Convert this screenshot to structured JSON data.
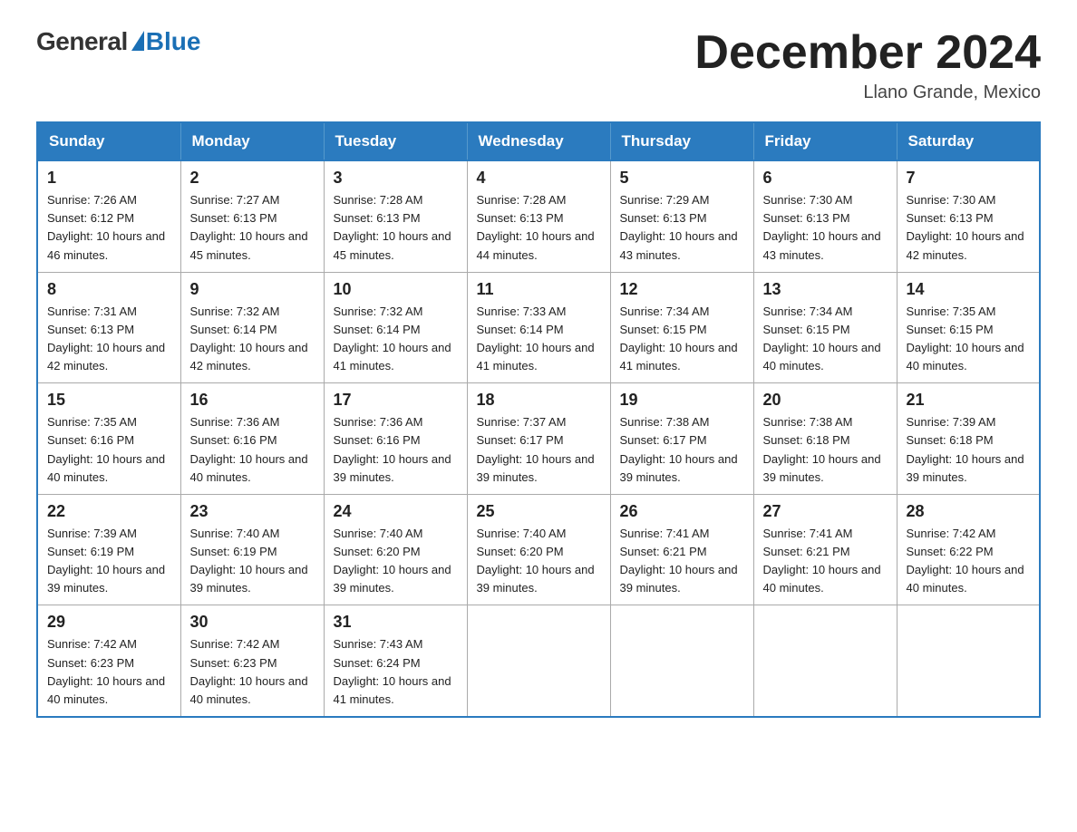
{
  "header": {
    "logo_general": "General",
    "logo_blue": "Blue",
    "month_title": "December 2024",
    "location": "Llano Grande, Mexico"
  },
  "weekdays": [
    "Sunday",
    "Monday",
    "Tuesday",
    "Wednesday",
    "Thursday",
    "Friday",
    "Saturday"
  ],
  "weeks": [
    [
      {
        "day": "1",
        "sunrise": "7:26 AM",
        "sunset": "6:12 PM",
        "daylight": "10 hours and 46 minutes."
      },
      {
        "day": "2",
        "sunrise": "7:27 AM",
        "sunset": "6:13 PM",
        "daylight": "10 hours and 45 minutes."
      },
      {
        "day": "3",
        "sunrise": "7:28 AM",
        "sunset": "6:13 PM",
        "daylight": "10 hours and 45 minutes."
      },
      {
        "day": "4",
        "sunrise": "7:28 AM",
        "sunset": "6:13 PM",
        "daylight": "10 hours and 44 minutes."
      },
      {
        "day": "5",
        "sunrise": "7:29 AM",
        "sunset": "6:13 PM",
        "daylight": "10 hours and 43 minutes."
      },
      {
        "day": "6",
        "sunrise": "7:30 AM",
        "sunset": "6:13 PM",
        "daylight": "10 hours and 43 minutes."
      },
      {
        "day": "7",
        "sunrise": "7:30 AM",
        "sunset": "6:13 PM",
        "daylight": "10 hours and 42 minutes."
      }
    ],
    [
      {
        "day": "8",
        "sunrise": "7:31 AM",
        "sunset": "6:13 PM",
        "daylight": "10 hours and 42 minutes."
      },
      {
        "day": "9",
        "sunrise": "7:32 AM",
        "sunset": "6:14 PM",
        "daylight": "10 hours and 42 minutes."
      },
      {
        "day": "10",
        "sunrise": "7:32 AM",
        "sunset": "6:14 PM",
        "daylight": "10 hours and 41 minutes."
      },
      {
        "day": "11",
        "sunrise": "7:33 AM",
        "sunset": "6:14 PM",
        "daylight": "10 hours and 41 minutes."
      },
      {
        "day": "12",
        "sunrise": "7:34 AM",
        "sunset": "6:15 PM",
        "daylight": "10 hours and 41 minutes."
      },
      {
        "day": "13",
        "sunrise": "7:34 AM",
        "sunset": "6:15 PM",
        "daylight": "10 hours and 40 minutes."
      },
      {
        "day": "14",
        "sunrise": "7:35 AM",
        "sunset": "6:15 PM",
        "daylight": "10 hours and 40 minutes."
      }
    ],
    [
      {
        "day": "15",
        "sunrise": "7:35 AM",
        "sunset": "6:16 PM",
        "daylight": "10 hours and 40 minutes."
      },
      {
        "day": "16",
        "sunrise": "7:36 AM",
        "sunset": "6:16 PM",
        "daylight": "10 hours and 40 minutes."
      },
      {
        "day": "17",
        "sunrise": "7:36 AM",
        "sunset": "6:16 PM",
        "daylight": "10 hours and 39 minutes."
      },
      {
        "day": "18",
        "sunrise": "7:37 AM",
        "sunset": "6:17 PM",
        "daylight": "10 hours and 39 minutes."
      },
      {
        "day": "19",
        "sunrise": "7:38 AM",
        "sunset": "6:17 PM",
        "daylight": "10 hours and 39 minutes."
      },
      {
        "day": "20",
        "sunrise": "7:38 AM",
        "sunset": "6:18 PM",
        "daylight": "10 hours and 39 minutes."
      },
      {
        "day": "21",
        "sunrise": "7:39 AM",
        "sunset": "6:18 PM",
        "daylight": "10 hours and 39 minutes."
      }
    ],
    [
      {
        "day": "22",
        "sunrise": "7:39 AM",
        "sunset": "6:19 PM",
        "daylight": "10 hours and 39 minutes."
      },
      {
        "day": "23",
        "sunrise": "7:40 AM",
        "sunset": "6:19 PM",
        "daylight": "10 hours and 39 minutes."
      },
      {
        "day": "24",
        "sunrise": "7:40 AM",
        "sunset": "6:20 PM",
        "daylight": "10 hours and 39 minutes."
      },
      {
        "day": "25",
        "sunrise": "7:40 AM",
        "sunset": "6:20 PM",
        "daylight": "10 hours and 39 minutes."
      },
      {
        "day": "26",
        "sunrise": "7:41 AM",
        "sunset": "6:21 PM",
        "daylight": "10 hours and 39 minutes."
      },
      {
        "day": "27",
        "sunrise": "7:41 AM",
        "sunset": "6:21 PM",
        "daylight": "10 hours and 40 minutes."
      },
      {
        "day": "28",
        "sunrise": "7:42 AM",
        "sunset": "6:22 PM",
        "daylight": "10 hours and 40 minutes."
      }
    ],
    [
      {
        "day": "29",
        "sunrise": "7:42 AM",
        "sunset": "6:23 PM",
        "daylight": "10 hours and 40 minutes."
      },
      {
        "day": "30",
        "sunrise": "7:42 AM",
        "sunset": "6:23 PM",
        "daylight": "10 hours and 40 minutes."
      },
      {
        "day": "31",
        "sunrise": "7:43 AM",
        "sunset": "6:24 PM",
        "daylight": "10 hours and 41 minutes."
      },
      null,
      null,
      null,
      null
    ]
  ],
  "labels": {
    "sunrise": "Sunrise:",
    "sunset": "Sunset:",
    "daylight": "Daylight:"
  }
}
